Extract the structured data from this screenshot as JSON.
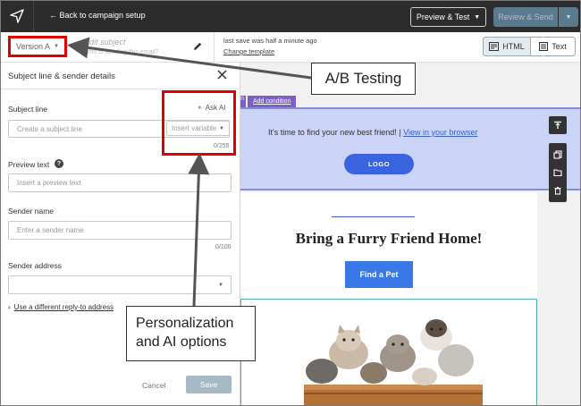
{
  "topbar": {
    "back_label": "Back to campaign setup",
    "preview_test_label": "Preview & Test",
    "review_send_label": "Review & Send"
  },
  "subbar": {
    "version_label": "Version A",
    "edit_subject_placeholder": "Edit subject",
    "edit_subject_sub": "Who is sending this email?",
    "last_save": "last save was half a minute ago",
    "change_template": "Change template",
    "html_label": "HTML",
    "text_label": "Text"
  },
  "panel": {
    "title": "Subject line & sender details",
    "subject_label": "Subject line",
    "subject_placeholder": "Create a subject line",
    "ask_ai": "Ask AI",
    "insert_variable": "Insert variable",
    "subject_counter": "0/255",
    "preview_label": "Preview text",
    "preview_placeholder": "Insert a preview text",
    "sender_name_label": "Sender name",
    "sender_name_placeholder": "Enter a sender name",
    "sender_name_counter": "0/100",
    "sender_address_label": "Sender address",
    "reply_link": "Use a different reply-to address",
    "cancel": "Cancel",
    "save": "Save"
  },
  "canvas": {
    "condition_tab_left": "n",
    "add_condition": "Add condition",
    "find_friend_text": "It's time to find your new best friend! | ",
    "view_browser": "View in your browser",
    "logo_label": "LOGO",
    "headline": "Bring a Furry Friend Home!",
    "find_pet_label": "Find a Pet"
  },
  "annotations": {
    "ab_testing": "A/B Testing",
    "personalization_line1": "Personalization",
    "personalization_line2": "and AI options"
  },
  "colors": {
    "topbar": "#2c2c2c",
    "highlight_red": "#e00000",
    "accent_blue": "#3a63e0",
    "condition_purple": "#7c5fc9",
    "section_blue": "#cbd3f6"
  }
}
